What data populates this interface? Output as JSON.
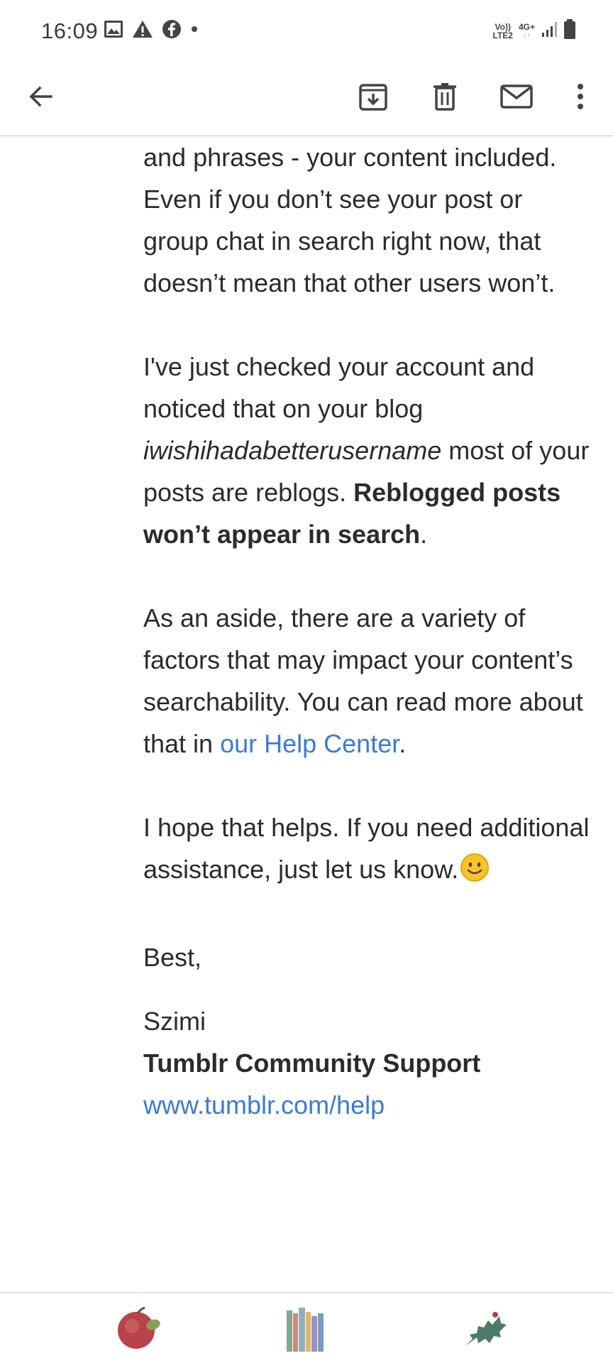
{
  "status_bar": {
    "time": "16:09",
    "left_icons": [
      "image-icon",
      "warning-icon",
      "facebook-icon",
      "dot-icon"
    ],
    "network": {
      "volte": "Vo))",
      "lte": "LTE2",
      "gen": "4G+"
    },
    "right_icons": [
      "signal-icon",
      "battery-icon"
    ]
  },
  "toolbar": {
    "back_icon": "arrow-left-icon",
    "actions": [
      "archive-icon",
      "delete-icon",
      "mark-unread-icon",
      "more-vert-icon"
    ]
  },
  "email": {
    "partial_top_line": "and phrases - your content included.",
    "para1": "Even if you don’t see your post or group chat in search right now, that doesn’t mean that other users won’t.",
    "para2_a": "I've just checked your account and noticed that on your blog ",
    "para2_blog": "iwishihadabetterusername",
    "para2_b": " most of your posts are reblogs. ",
    "para2_bold": "Reblogged posts won’t appear in search",
    "para2_end": ".",
    "para3_a": "As an aside, there are a variety of factors that may impact your content’s searchability. You can read more about that in ",
    "para3_link": "our Help Center",
    "para3_end": ".",
    "para4": "I hope that helps. If you need additional assistance, just let us know.",
    "signoff": "Best,",
    "signer_name": "Szimi",
    "signer_team": "Tumblr Community Support",
    "signer_link": "www.tumblr.com/help"
  },
  "bottom_bar": {
    "items": [
      "apple-icon",
      "books-icon",
      "holly-leaf-icon"
    ]
  }
}
